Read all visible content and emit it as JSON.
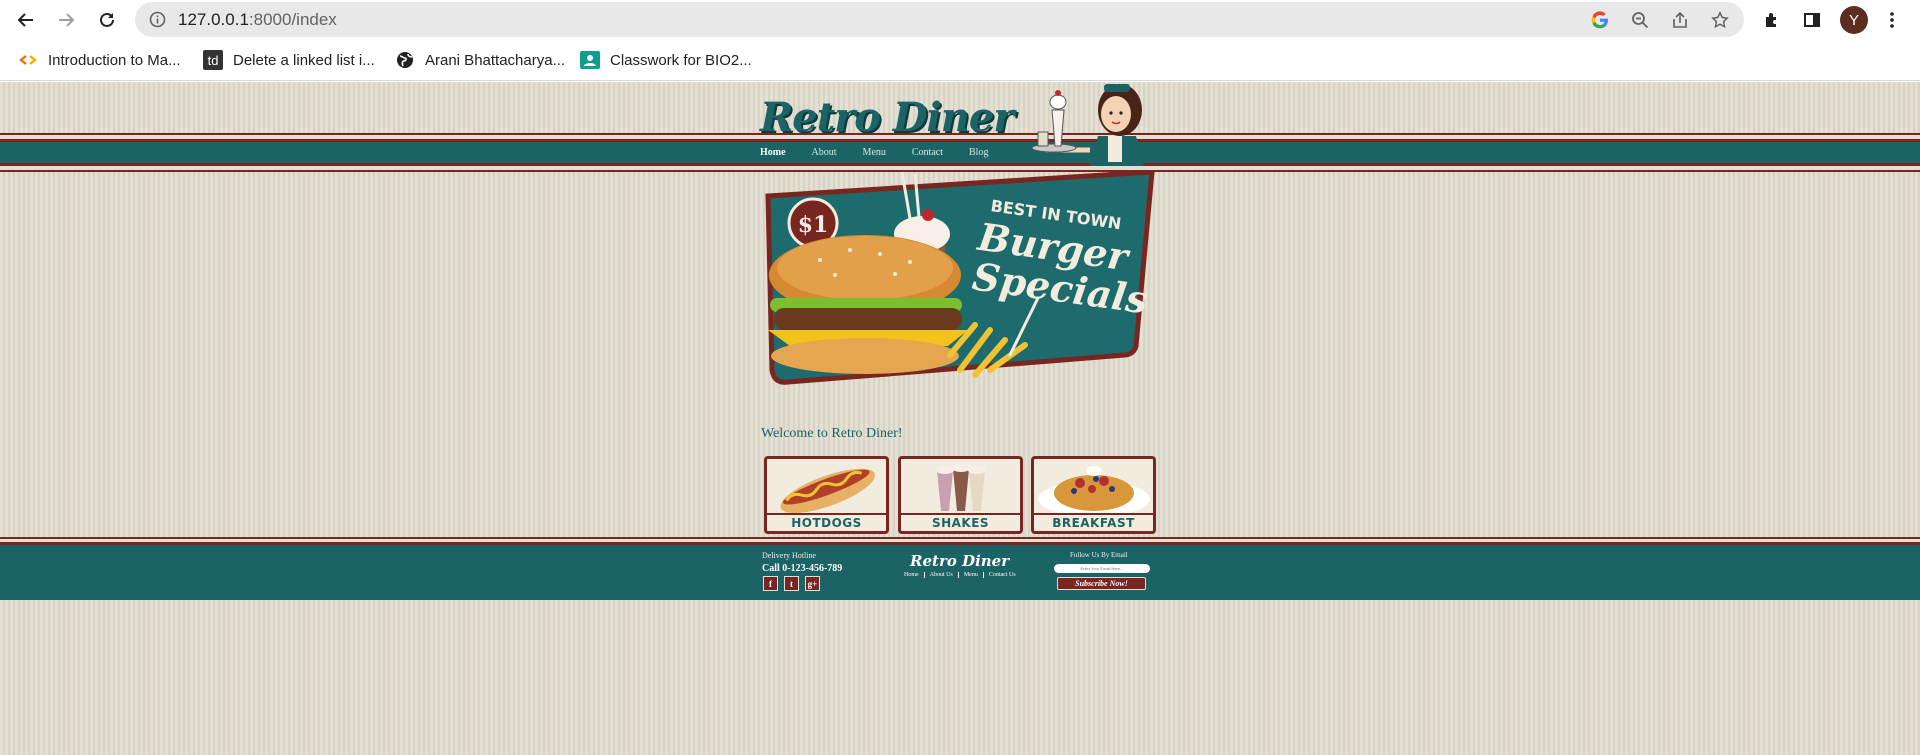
{
  "browser": {
    "url_host": "127.0.0.1",
    "url_rest": ":8000/index",
    "avatar_letter": "Y",
    "icons": [
      "back-icon",
      "forward-icon",
      "reload-icon",
      "info-icon",
      "google-icon",
      "zoom-icon",
      "share-icon",
      "star-icon",
      "extensions-icon",
      "side-panel-icon",
      "menu-icon"
    ]
  },
  "bookmarks": [
    {
      "label": "Introduction to Ma...",
      "icon": "colab-icon"
    },
    {
      "label": "Delete a linked list i...",
      "icon": "td-icon",
      "icon_text": "td"
    },
    {
      "label": "Arani Bhattacharya...",
      "icon": "globe-icon"
    },
    {
      "label": "Classwork for BIO2...",
      "icon": "classroom-icon"
    }
  ],
  "site": {
    "logo": "Retro Diner",
    "nav": [
      {
        "label": "Home",
        "active": true
      },
      {
        "label": "About",
        "active": false
      },
      {
        "label": "Menu",
        "active": false
      },
      {
        "label": "Contact",
        "active": false
      },
      {
        "label": "Blog",
        "active": false
      }
    ],
    "hero": {
      "price": "$1",
      "tagline": "BEST IN TOWN",
      "title_line1": "Burger",
      "title_line2": "Specials"
    },
    "welcome": "Welcome to Retro Diner!",
    "tiles": [
      {
        "label": "HOTDOGS"
      },
      {
        "label": "SHAKES"
      },
      {
        "label": "BREAKFAST"
      }
    ],
    "footer": {
      "hotline_title": "Delivery Hotline",
      "hotline": "Call 0-123-456-789",
      "social": [
        "f",
        "t",
        "g+"
      ],
      "logo": "Retro Diner",
      "links": [
        "Home",
        "About Us",
        "Menu",
        "Contact Us"
      ],
      "follow_title": "Follow Us By Email",
      "email_placeholder": "Enter Your Email Here...",
      "subscribe": "Subscribe Now!"
    }
  },
  "colors": {
    "teal": "#1c6366",
    "maroon": "#7a2620",
    "cream": "#e3dfd3"
  }
}
